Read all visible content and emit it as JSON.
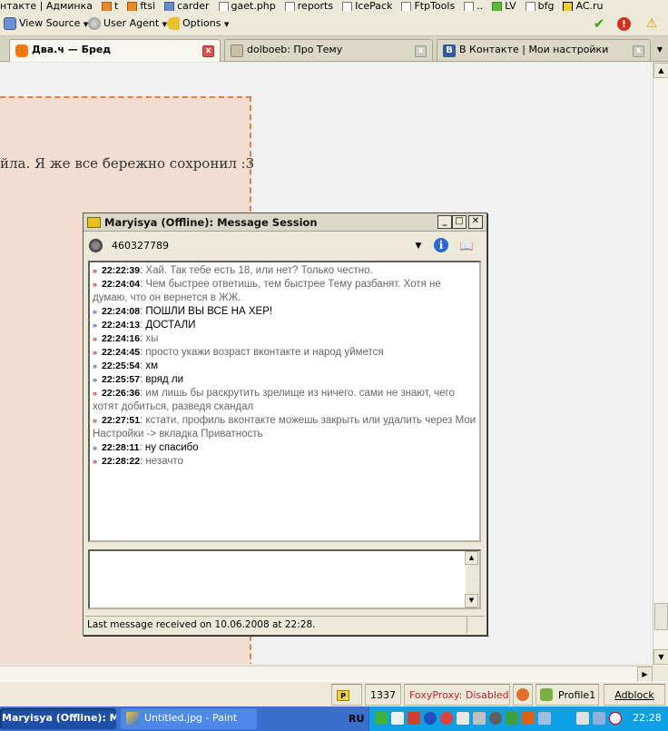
{
  "bookmarks": [
    {
      "label": "нтакте | Админка",
      "icon": "none"
    },
    {
      "label": "t",
      "icon": "orange"
    },
    {
      "label": "ftsi",
      "icon": "orange"
    },
    {
      "label": "carder",
      "icon": "blue"
    },
    {
      "label": "gaet.php",
      "icon": "page"
    },
    {
      "label": "reports",
      "icon": "page"
    },
    {
      "label": "IcePack",
      "icon": "page"
    },
    {
      "label": "FtpTools",
      "icon": "page"
    },
    {
      "label": "..",
      "icon": "page"
    },
    {
      "label": "LV",
      "icon": "green"
    },
    {
      "label": "bfg",
      "icon": "page"
    },
    {
      "label": "AC.ru",
      "icon": "yellow"
    }
  ],
  "devbar": {
    "view_source": "View Source",
    "user_agent": "User Agent",
    "options": "Options"
  },
  "tabs": [
    {
      "label": "Два.ч — Бред",
      "active": true
    },
    {
      "label": "dolboeb: Про Тему",
      "active": false
    },
    {
      "label": "В Контакте | Мои настройки",
      "active": false
    }
  ],
  "page": {
    "post_text": "йла. Я же все бережно сохронил :3"
  },
  "msg_window": {
    "title": "Maryisya (Offline): Message Session",
    "uin": "460327789",
    "messages": [
      {
        "dir": "in",
        "time": "22:22:39",
        "text": "Хай. Так тебе есть 18, или нет? Только честно."
      },
      {
        "dir": "in",
        "time": "22:24:04",
        "text": "Чем быстрее ответишь, тем быстрее Тему разбанят. Хотя не думаю, что он вернется в ЖЖ."
      },
      {
        "dir": "out",
        "time": "22:24:08",
        "text": "ПОШЛИ ВЫ ВСЕ НА ХЕР!"
      },
      {
        "dir": "out",
        "time": "22:24:13",
        "text": "ДОСТАЛИ"
      },
      {
        "dir": "in",
        "time": "22:24:16",
        "text": "хы"
      },
      {
        "dir": "in",
        "time": "22:24:45",
        "text": "просто укажи возраст вконтакте и народ уймется"
      },
      {
        "dir": "out",
        "time": "22:25:54",
        "text": "хм"
      },
      {
        "dir": "out",
        "time": "22:25:57",
        "text": "вряд ли"
      },
      {
        "dir": "in",
        "time": "22:26:36",
        "text": "им лишь бы раскрутить зрелище из ничего. сами не знают, чего хотят добиться, разведя скандал"
      },
      {
        "dir": "in",
        "time": "22:27:51",
        "text": "кстати, профиль вконтакте можешь закрыть или удалить через Мои Настройки -> вкладка Приватность"
      },
      {
        "dir": "out",
        "time": "22:28:11",
        "text": "ну спасибо"
      },
      {
        "dir": "in",
        "time": "22:28:22",
        "text": "незачто"
      }
    ],
    "compose_value": "",
    "status": "Last message received on 10.06.2008 at 22:28."
  },
  "statusbar": {
    "counter": "1337",
    "foxyproxy": "FoxyProxy: Disabled",
    "profile": "Profile1",
    "adblock": "Adblock"
  },
  "taskbar": {
    "tasks": [
      {
        "label": "Maryisya (Offline): M...",
        "active": true
      },
      {
        "label": "Untitled.jpg - Paint",
        "active": false
      }
    ],
    "lang": "RU",
    "clock": "22:28"
  },
  "colors": {
    "post_bg": "#f2ddd0",
    "post_border": "#e08040",
    "taskbar": "#3a6fd0",
    "tray": "#0f9fe6",
    "foxyproxy_text": "#c0202a"
  }
}
